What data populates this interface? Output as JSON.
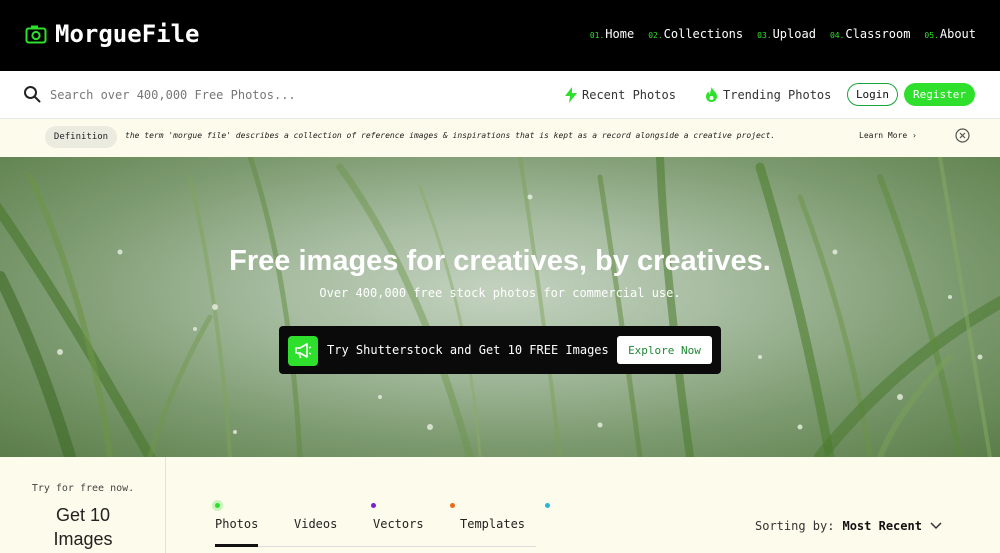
{
  "brand": {
    "name": "MorgueFile",
    "accent": "#2ee02b"
  },
  "nav": [
    {
      "num": "01.",
      "label": "Home"
    },
    {
      "num": "02.",
      "label": "Collections"
    },
    {
      "num": "03.",
      "label": "Upload"
    },
    {
      "num": "04.",
      "label": "Classroom"
    },
    {
      "num": "05.",
      "label": "About"
    }
  ],
  "search": {
    "placeholder": "Search over 400,000 Free Photos...",
    "value": ""
  },
  "quick_links": {
    "recent": "Recent Photos",
    "trending": "Trending Photos"
  },
  "auth": {
    "login": "Login",
    "register": "Register"
  },
  "definition": {
    "badge": "Definition",
    "text": "the term 'morgue file' describes a collection of reference images & inspirations that is kept as a record alongside a creative project.",
    "more": "Learn More ›"
  },
  "hero": {
    "title": "Free images for creatives, by creatives.",
    "subtitle": "Over 400,000 free stock photos for commercial use.",
    "promo_text": "Try Shutterstock and Get 10 FREE Images",
    "promo_button": "Explore Now"
  },
  "side_promo": {
    "try": "Try for free now.",
    "line1": "Get 10",
    "line2": "Images"
  },
  "tabs": [
    {
      "label": "Photos",
      "dot_color": "#2ee02b",
      "active": true
    },
    {
      "label": "Videos",
      "dot_color": "#7a1fd6",
      "active": false
    },
    {
      "label": "Vectors",
      "dot_color": "#e86a1a",
      "active": false
    },
    {
      "label": "Templates",
      "dot_color": "#28b6d4",
      "active": false
    }
  ],
  "sorting": {
    "label": "Sorting by:",
    "value": "Most Recent"
  }
}
